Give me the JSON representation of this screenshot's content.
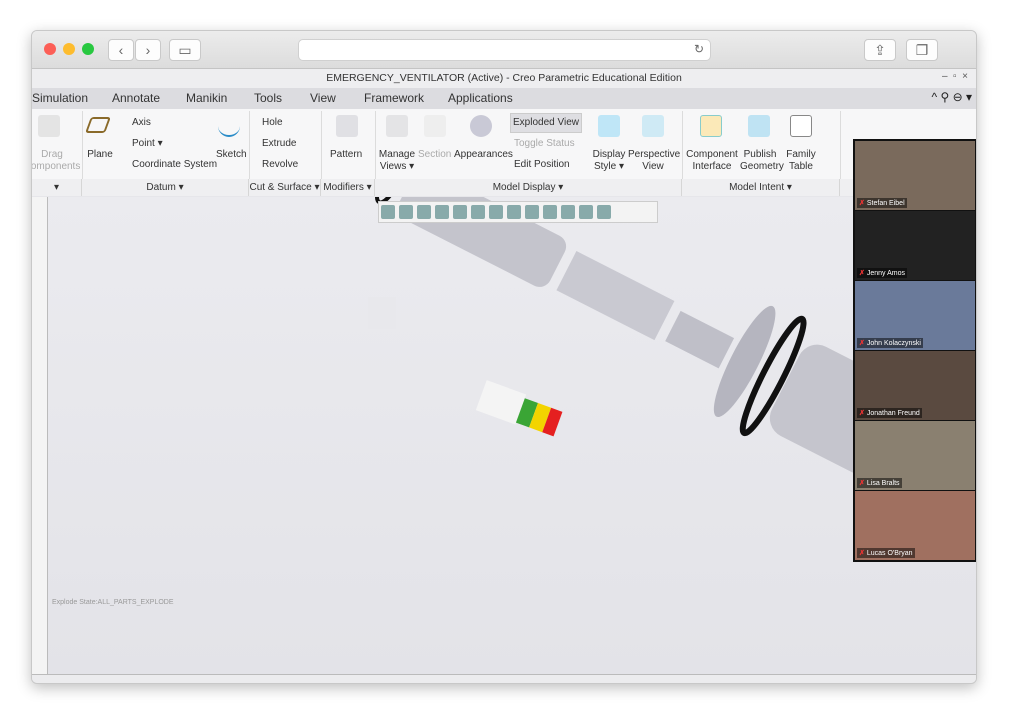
{
  "window": {
    "title": "EMERGENCY_VENTILATOR (Active) - Creo Parametric Educational Edition"
  },
  "tabs": [
    "Simulation",
    "Annotate",
    "Manikin",
    "Tools",
    "View",
    "Framework",
    "Applications"
  ],
  "ribbon": {
    "drag": "Drag Components",
    "plane": "Plane",
    "axis": "Axis",
    "point": "Point ▾",
    "csys": "Coordinate System",
    "sketch": "Sketch",
    "hole": "Hole",
    "extrude": "Extrude",
    "revolve": "Revolve",
    "pattern": "Pattern",
    "manage_views": "Manage Views ▾",
    "section": "Section",
    "appearances": "Appearances",
    "exploded_view": "Exploded View",
    "toggle_status": "Toggle Status",
    "edit_position": "Edit Position",
    "display_style": "Display Style ▾",
    "perspective_view": "Perspective View",
    "component_interface": "Component Interface",
    "publish_geometry": "Publish Geometry",
    "family_table": "Family Table",
    "groups": {
      "datum": "Datum ▾",
      "cut_surface": "Cut & Surface ▾",
      "modifiers": "Modifiers ▾",
      "model_display": "Model Display ▾",
      "model_intent": "Model Intent ▾"
    }
  },
  "viewport": {
    "explode_state": "Explode State:ALL_PARTS_EXPLODE"
  },
  "participants": [
    "Stefan Eibel",
    "Jenny Amos",
    "John Kolaczynski",
    "Jonathan Freund",
    "Lisa Bralts",
    "Lucas O'Bryan"
  ],
  "colors": {
    "accent": "#2b6fd1",
    "exploded_active": "#dedee2"
  }
}
